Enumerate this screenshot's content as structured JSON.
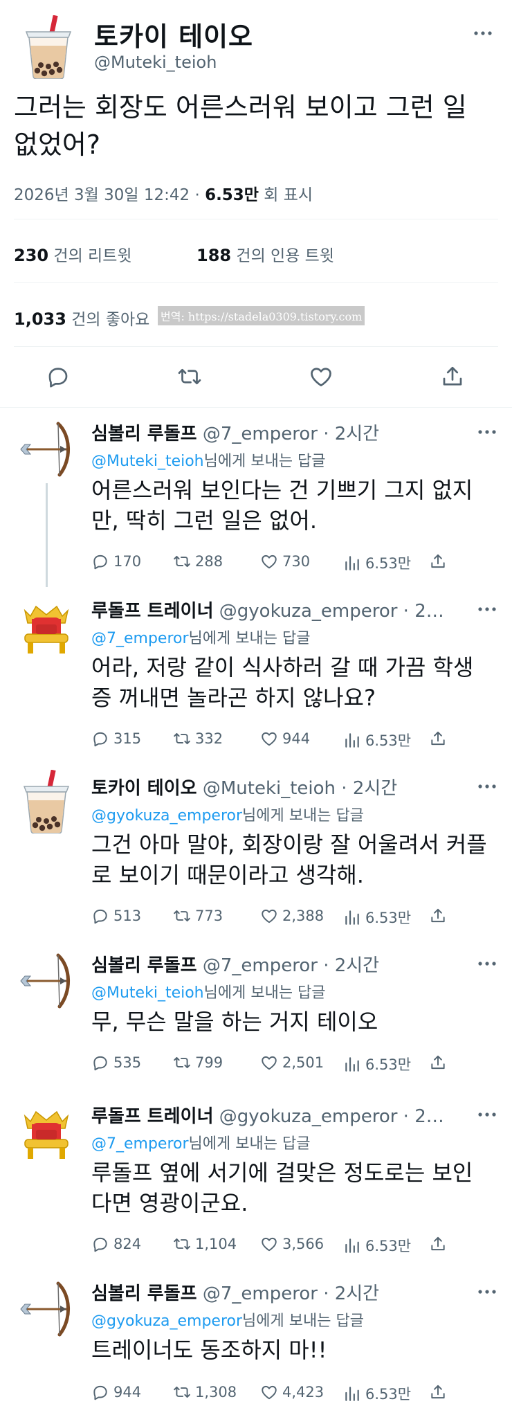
{
  "main_tweet": {
    "display_name": "토카이 테이오",
    "handle": "@Muteki_teioh",
    "text": "그러는 회장도 어른스러워 보이고 그런 일 없었어?",
    "date": "2026년 3월 30일 12:42 · ",
    "views": "6.53만",
    "views_label": " 회 표시",
    "retweets_count": "230",
    "retweets_label": "건의 리트윗",
    "quotes_count": "188",
    "quotes_label": "건의 인용 트윗",
    "likes_count": "1,033",
    "likes_label": "건의 좋아요",
    "watermark": "번역: https://stadela0309.tistory.com"
  },
  "replies": [
    {
      "display_name": "심볼리 루돌프",
      "handle_time": " @7_emperor · 2시간",
      "reply_to": "@Muteki_teioh",
      "reply_suffix": "님에게 보내는 답글",
      "text": "어른스러워 보인다는 건 기쁘기 그지 없지만, 딱히 그런 일은 없어.",
      "avatar": "bow-arrow-icon",
      "counts": {
        "replies": "170",
        "retweets": "288",
        "likes": "730",
        "views": "6.53만"
      }
    },
    {
      "display_name": "루돌프 트레이너",
      "handle_time": " @gyokuza_emperor · 2…",
      "reply_to": "@7_emperor",
      "reply_suffix": "님에게 보내는 답글",
      "text": "어라, 저랑 같이 식사하러 갈 때 가끔 학생증 꺼내면 놀라곤 하지 않나요?",
      "avatar": "throne-icon",
      "counts": {
        "replies": "315",
        "retweets": "332",
        "likes": "944",
        "views": "6.53만"
      }
    },
    {
      "display_name": "토카이 테이오",
      "handle_time": " @Muteki_teioh · 2시간",
      "reply_to": "@gyokuza_emperor",
      "reply_suffix": "님에게 보내는 답글",
      "text": "그건 아마 말야, 회장이랑 잘 어울려서 커플로 보이기 때문이라고 생각해.",
      "avatar": "bubble-tea-icon",
      "counts": {
        "replies": "513",
        "retweets": "773",
        "likes": "2,388",
        "views": "6.53만"
      }
    },
    {
      "display_name": "심볼리 루돌프",
      "handle_time": " @7_emperor · 2시간",
      "reply_to": "@Muteki_teioh",
      "reply_suffix": "님에게 보내는 답글",
      "text": "무, 무슨 말을 하는 거지 테이오",
      "avatar": "bow-arrow-icon",
      "counts": {
        "replies": "535",
        "retweets": "799",
        "likes": "2,501",
        "views": "6.53만"
      }
    },
    {
      "display_name": "루돌프 트레이너",
      "handle_time": " @gyokuza_emperor · 2…",
      "reply_to": "@7_emperor",
      "reply_suffix": "님에게 보내는 답글",
      "text": "루돌프 옆에 서기에 걸맞은 정도로는 보인다면 영광이군요.",
      "avatar": "throne-icon",
      "counts": {
        "replies": "824",
        "retweets": "1,104",
        "likes": "3,566",
        "views": "6.53만"
      }
    },
    {
      "display_name": "심볼리 루돌프",
      "handle_time": " @7_emperor · 2시간",
      "reply_to": "@gyokuza_emperor",
      "reply_suffix": "님에게 보내는 답글",
      "text": "트레이너도 동조하지 마!!",
      "avatar": "bow-arrow-icon",
      "counts": {
        "replies": "944",
        "retweets": "1,308",
        "likes": "4,423",
        "views": "6.53만"
      }
    }
  ],
  "colors": {
    "link": "#1d9bf0",
    "muted": "#536471",
    "text": "#0f1419",
    "divider": "#eff3f4"
  }
}
